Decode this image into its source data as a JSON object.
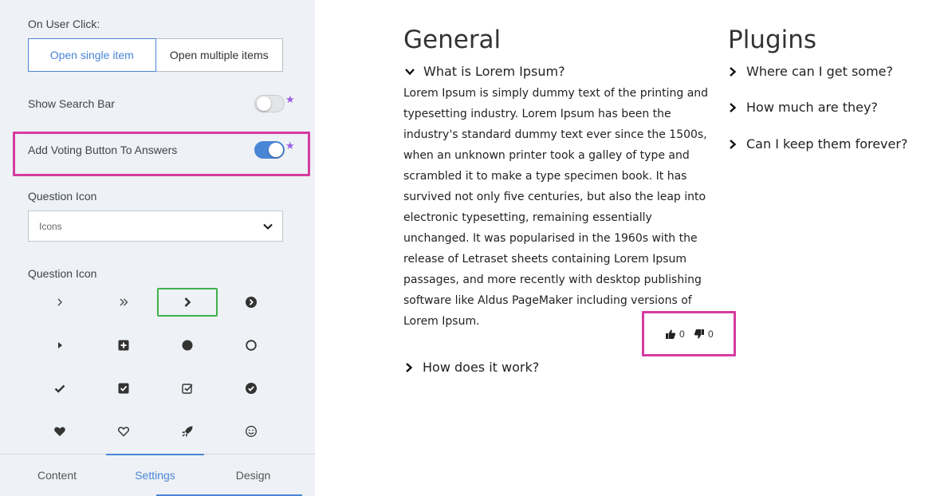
{
  "settings": {
    "on_user_click_label": "On User Click:",
    "open_single_label": "Open single item",
    "open_multiple_label": "Open multiple items",
    "show_search_bar_label": "Show Search Bar",
    "show_search_bar_enabled": false,
    "add_voting_label": "Add Voting Button To Answers",
    "add_voting_enabled": true,
    "question_icon_label": "Question Icon",
    "question_icon_select_value": "Icons",
    "question_icon_grid_label": "Question Icon",
    "icons": [
      "angle-right-icon",
      "angle-double-right-icon",
      "chevron-right-icon",
      "chevron-circle-right-icon",
      "caret-right-icon",
      "plus-square-icon",
      "circle-icon",
      "circle-outline-icon",
      "check-icon",
      "check-square-icon",
      "check-square-outline-icon",
      "check-circle-icon",
      "heart-icon",
      "heart-outline-icon",
      "rocket-icon",
      "smile-icon"
    ],
    "selected_icon": "chevron-right-icon",
    "pro_star": "★"
  },
  "tabs": {
    "content": "Content",
    "settings": "Settings",
    "design": "Design",
    "active": "Settings"
  },
  "preview": {
    "general_heading": "General",
    "plugins_heading": "Plugins",
    "general_questions": [
      "What is Lorem Ipsum?",
      "How does it work?"
    ],
    "plugins_questions": [
      "Where can I get some?",
      "How much are they?",
      "Can I keep them forever?"
    ],
    "answer_text": "Lorem Ipsum is simply dummy text of the printing and typesetting industry. Lorem Ipsum has been the industry's standard dummy text ever since the 1500s, when an unknown printer took a galley of type and scrambled it to make a type specimen book. It has survived not only five centuries, but also the leap into electronic typesetting, remaining essentially unchanged. It was popularised in the 1960s with the release of Letraset sheets containing Lorem Ipsum passages, and more recently with desktop publishing software like Aldus PageMaker including versions of Lorem Ipsum.",
    "upvotes": "0",
    "downvotes": "0"
  },
  "colors": {
    "accent": "#4a86d6",
    "highlight": "#d63ba0",
    "selected_icon_border": "#3db14a",
    "star": "#9b5de5"
  }
}
